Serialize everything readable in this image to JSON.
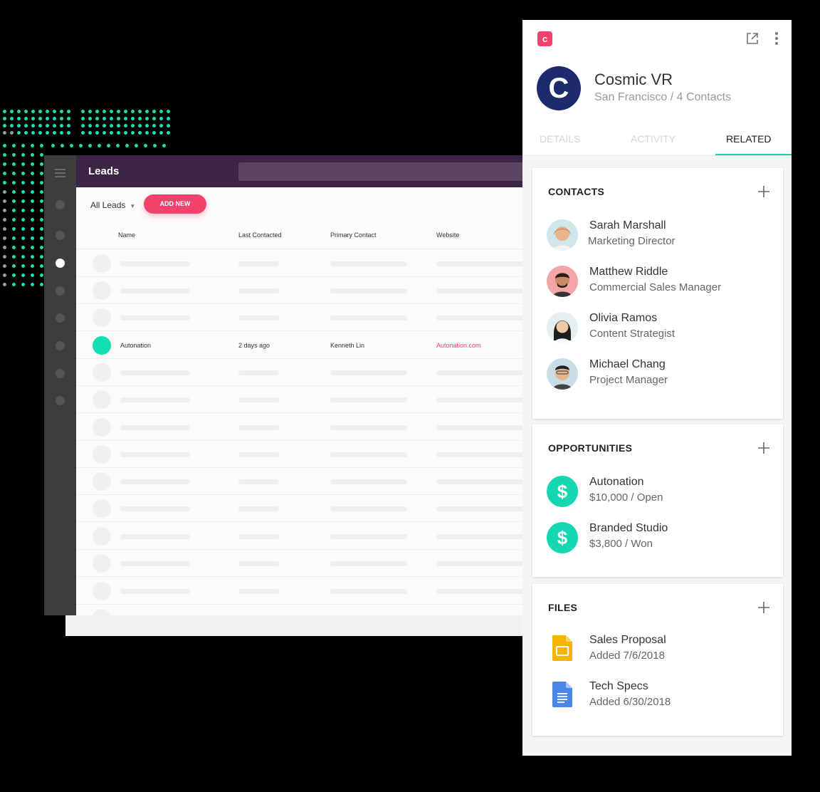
{
  "leads_app": {
    "title": "Leads",
    "filter_label": "All Leads",
    "add_new_label": "ADD NEW",
    "columns": [
      "Name",
      "Last Contacted",
      "Primary Contact",
      "Website"
    ],
    "lead": {
      "name": "Autonation",
      "last_contacted": "2 days ago",
      "primary_contact": "Kenneth Lin",
      "website": "Autonation.com"
    }
  },
  "panel": {
    "avatar_letter": "C",
    "company": "Cosmic VR",
    "subtitle": "San Francisco / 4 Contacts",
    "tabs": [
      {
        "label": "DETAILS",
        "active": false
      },
      {
        "label": "ACTIVITY",
        "active": false
      },
      {
        "label": "RELATED",
        "active": true
      }
    ],
    "contacts": {
      "title": "CONTACTS",
      "items": [
        {
          "name": "Sarah Marshall",
          "role": "Marketing Director"
        },
        {
          "name": "Matthew Riddle",
          "role": "Commercial Sales Manager"
        },
        {
          "name": "Olivia Ramos",
          "role": "Content Strategist"
        },
        {
          "name": "Michael Chang",
          "role": "Project Manager"
        }
      ]
    },
    "opportunities": {
      "title": "OPPORTUNITIES",
      "items": [
        {
          "name": "Autonation",
          "detail": "$10,000 / Open"
        },
        {
          "name": "Branded Studio",
          "detail": "$3,800 / Won"
        }
      ]
    },
    "files": {
      "title": "FILES",
      "items": [
        {
          "name": "Sales Proposal",
          "detail": "Added 7/6/2018",
          "icon": "google-slides-icon"
        },
        {
          "name": "Tech Specs",
          "detail": "Added 6/30/2018",
          "icon": "google-docs-icon"
        }
      ]
    }
  },
  "colors": {
    "accent_pink": "#f2416a",
    "accent_teal": "#14d6b0",
    "topbar_purple": "#3c2444",
    "avatar_navy": "#1c2a6e"
  }
}
